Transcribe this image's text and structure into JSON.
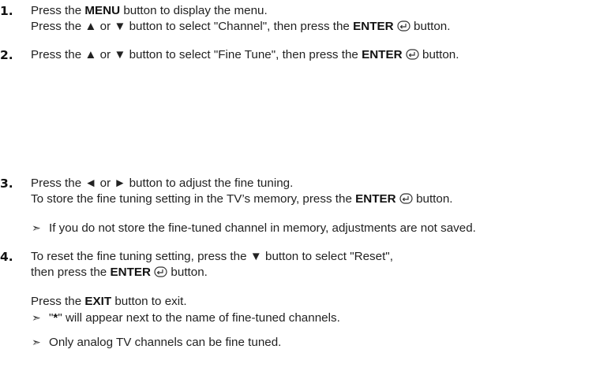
{
  "step1": {
    "number": "1.",
    "line1": [
      "Press the ",
      "MENU",
      " button to display the menu."
    ],
    "line2": [
      "Press the ▲ or ▼ button to select \"Channel\", then press the ",
      "ENTER",
      " button."
    ]
  },
  "step2": {
    "number": "2.",
    "line1": [
      "Press the ▲ or ▼ button to select \"Fine Tune\", then press the ",
      "ENTER",
      " button."
    ]
  },
  "step3": {
    "number": "3.",
    "line1": "Press the ◄ or ► button to adjust the fine tuning.",
    "line2": [
      "To store the fine tuning setting in the TV’s memory, press the ",
      "ENTER",
      " button."
    ],
    "note": "If you do not store the fine-tuned channel in memory, adjustments are not saved."
  },
  "step4": {
    "number": "4.",
    "line1": "To reset the fine tuning setting, press the ▼ button to select \"Reset\",",
    "line2": [
      "then press  the ",
      "ENTER",
      " button."
    ],
    "exit": [
      "Press the ",
      "EXIT",
      " button to exit."
    ],
    "note1": [
      "\"",
      "*",
      "\" will appear next to the name of fine-tuned channels."
    ],
    "note2": "Only analog TV channels can be fine tuned."
  },
  "note_arrow": "➣",
  "icons": {
    "enter": "enter-icon"
  }
}
